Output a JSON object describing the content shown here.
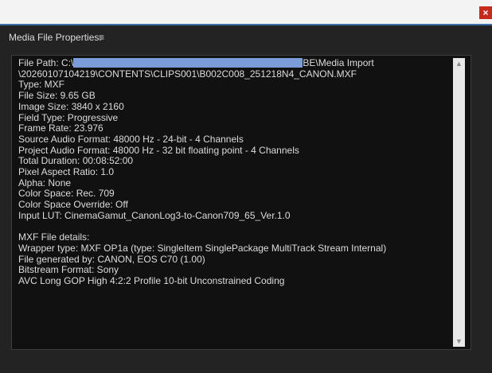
{
  "window": {
    "close_label": "×"
  },
  "panel": {
    "title": "Media File Properties:",
    "menu_icon": "hamburger-menu-icon",
    "menu_glyph": "≡"
  },
  "properties": {
    "file_path_prefix": "File Path: C:\\",
    "file_path_suffix": "BE\\Media Import",
    "file_path_line2": "\\20260107104219\\CONTENTS\\CLIPS001\\B002C008_251218N4_CANON.MXF",
    "type": "Type: MXF",
    "file_size": "File Size: 9.65 GB",
    "image_size": "Image Size: 3840 x 2160",
    "field_type": "Field Type: Progressive",
    "frame_rate": "Frame Rate: 23.976",
    "source_audio": "Source Audio Format: 48000 Hz - 24-bit - 4 Channels",
    "project_audio": "Project Audio Format: 48000 Hz - 32 bit floating point - 4 Channels",
    "total_duration": "Total Duration: 00:08:52:00",
    "pixel_aspect": "Pixel Aspect Ratio: 1.0",
    "alpha": "Alpha: None",
    "color_space": "Color Space: Rec. 709",
    "color_space_override": "Color Space Override: Off",
    "input_lut": "Input LUT: CinemaGamut_CanonLog3-to-Canon709_65_Ver.1.0",
    "mxf_header": "MXF File details:",
    "wrapper_type": "Wrapper type: MXF OP1a (type: SingleItem SinglePackage MultiTrack Stream Internal)",
    "generated_by": "File generated by: CANON, EOS C70 (1.00)",
    "bitstream": "Bitstream Format: Sony",
    "codec": "AVC Long GOP High 4:2:2 Profile 10-bit Unconstrained Coding"
  },
  "scrollbar": {
    "up_glyph": "▲",
    "down_glyph": "▼"
  }
}
